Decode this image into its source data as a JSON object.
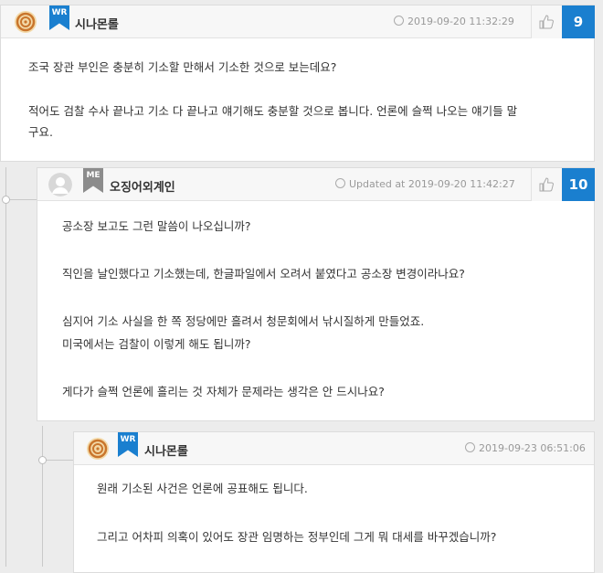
{
  "comments": [
    {
      "nick": "시나몬롤",
      "badge": "WR",
      "date": "2019-09-20 11:32:29",
      "votes": "9",
      "lines": [
        "조국 장관 부인은 충분히 기소할 만해서 기소한 것으로 보는데요?",
        "",
        "적어도 검찰 수사 끝나고 기소 다 끝나고 얘기해도 충분할 것으로 봅니다. 언론에 슬쩍 나오는 얘기들 말",
        "구요."
      ]
    },
    {
      "nick": "오징어외계인",
      "badge": "ME",
      "date": "Updated at 2019-09-20 11:42:27",
      "votes": "10",
      "lines": [
        "공소장 보고도 그런 말씀이 나오십니까?",
        "",
        "직인을 날인했다고 기소했는데, 한글파일에서 오려서 붙였다고 공소장 변경이라나요?",
        "",
        "심지어 기소 사실을 한 쪽 정당에만 흘려서 청문회에서 낚시질하게 만들었죠.",
        "미국에서는 검찰이 이렇게 해도 됩니까?",
        "",
        "게다가 슬쩍 언론에 흘리는 것 자체가 문제라는 생각은 안 드시나요?"
      ]
    },
    {
      "nick": "시나몬롤",
      "badge": "WR",
      "date": "2019-09-23 06:51:06",
      "lines": [
        "원래 기소된 사건은 언론에 공표해도 됩니다.",
        "",
        "그리고 어차피 의혹이 있어도 장관 임명하는 정부인데 그게 뭐 대세를 바꾸겠습니까?"
      ]
    }
  ],
  "colors": {
    "accent": "#1a7fcf",
    "badge_wr": "#1a7fcf",
    "badge_me": "#8c8c8c"
  }
}
